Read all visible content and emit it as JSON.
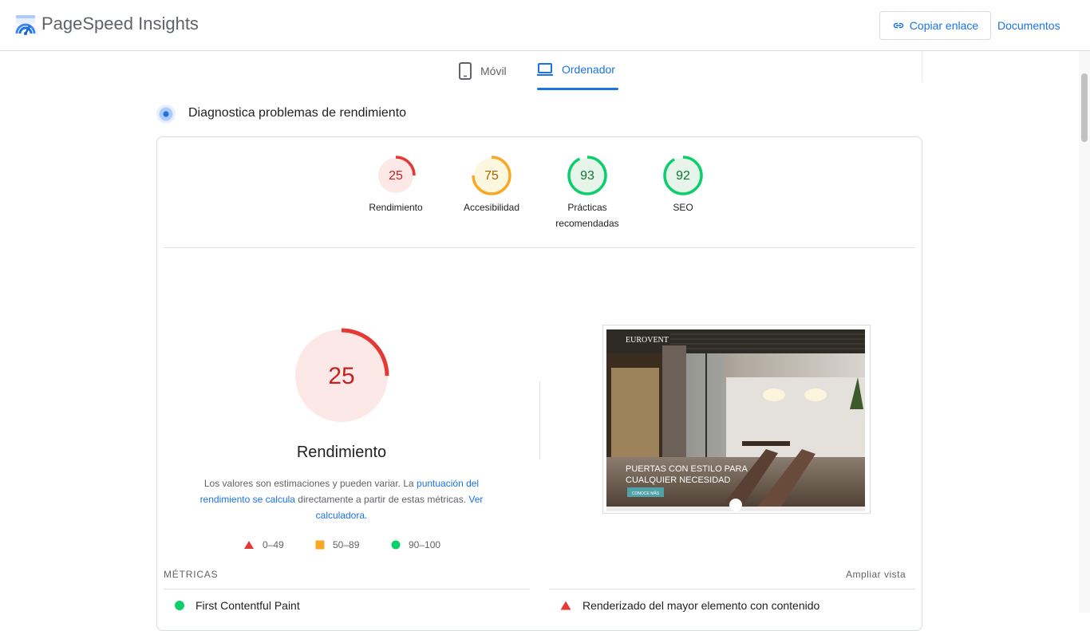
{
  "header": {
    "app_title": "PageSpeed Insights",
    "copy_link_label": "Copiar enlace",
    "docs_label": "Documentos"
  },
  "tabs": [
    {
      "label": "Móvil",
      "active": false
    },
    {
      "label": "Ordenador",
      "active": true
    }
  ],
  "section_title": "Diagnostica problemas de rendimiento",
  "categories": [
    {
      "label": "Rendimiento",
      "score": "25",
      "score_fraction": 0.25,
      "color": "#e53935"
    },
    {
      "label": "Accesibilidad",
      "score": "75",
      "score_fraction": 0.75,
      "color": "#f9a825"
    },
    {
      "label": "Prácticas recomendadas",
      "score": "93",
      "score_fraction": 0.93,
      "color": "#0cce6b"
    },
    {
      "label": "SEO",
      "score": "92",
      "score_fraction": 0.92,
      "color": "#0cce6b"
    }
  ],
  "main_score": {
    "score": "25",
    "score_fraction": 0.25,
    "label": "Rendimiento",
    "desc_part1": "Los valores son estimaciones y pueden variar. La ",
    "desc_link1": "puntuación del rendimiento se calcula",
    "desc_part2": " directamente a partir de estas métricas. ",
    "desc_link2": "Ver calculadora."
  },
  "legend": [
    {
      "range": "0–49",
      "color": "#e53935",
      "shape": "triangle"
    },
    {
      "range": "50–89",
      "color": "#f9a825",
      "shape": "square"
    },
    {
      "range": "90–100",
      "color": "#0cce6b",
      "shape": "circle"
    }
  ],
  "screenshot": {
    "brand": "EUROVENT",
    "headline_line1": "PUERTAS CON ESTILO PARA",
    "headline_line2": "CUALQUIER NECESIDAD",
    "cta": "CONOCE MÁS"
  },
  "metrics": {
    "label": "MÉTRICAS",
    "expand_label": "Ampliar vista",
    "items": [
      {
        "name": "First Contentful Paint",
        "status": "good",
        "color": "#0cce6b"
      },
      {
        "name": "Renderizado del mayor elemento con contenido",
        "status": "poor",
        "color": "#e53935"
      }
    ]
  }
}
